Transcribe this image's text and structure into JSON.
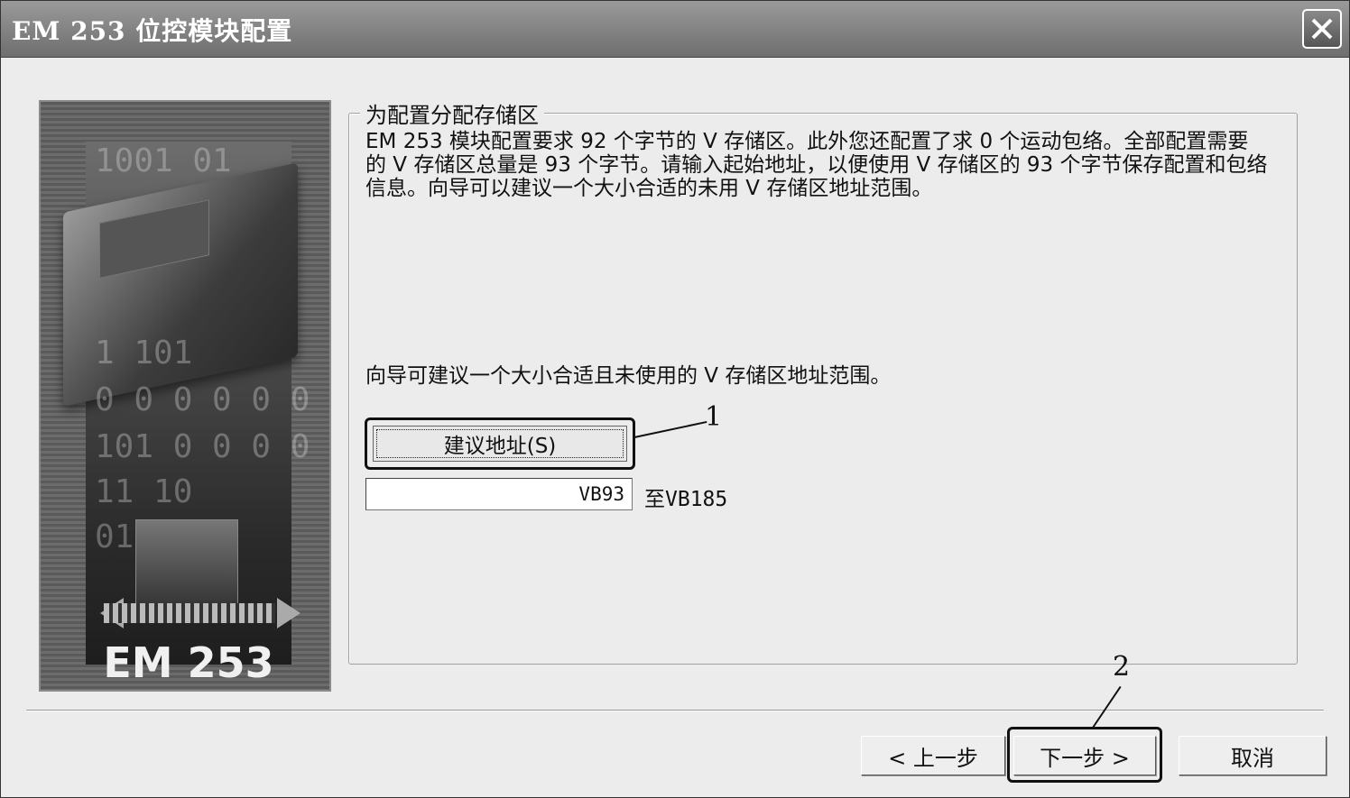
{
  "window": {
    "title": "EM 253 位控模块配置",
    "close_glyph": "✕"
  },
  "image_panel": {
    "digits_row1": "1001  01",
    "digits_row2": "1    101",
    "digits_row3": "0  0 0 0 0 0",
    "digits_row4": "101 0 0 0 0",
    "digits_row5": "11         10",
    "digits_row6": "01          0",
    "caption": "EM 253"
  },
  "group": {
    "title": "为配置分配存储区",
    "description": "EM 253 模块配置要求 92 个字节的 V 存储区。此外您还配置了求 0 个运动包络。全部配置需要的 V 存储区总量是 93 个字节。请输入起始地址，以便使用 V 存储区的 93 个字节保存配置和包络信息。向导可以建议一个大小合适的未用 V 存储区地址范围。",
    "hint": "向导可建议一个大小合适且未使用的 V 存储区地址范围。",
    "suggest_button": "建议地址(S)",
    "start_address": "VB93",
    "end_address": "至VB185"
  },
  "callouts": {
    "one": "1",
    "two": "2"
  },
  "footer": {
    "back_button": "< 上一步",
    "next_button": "下一步 >",
    "cancel_button": "取消"
  }
}
